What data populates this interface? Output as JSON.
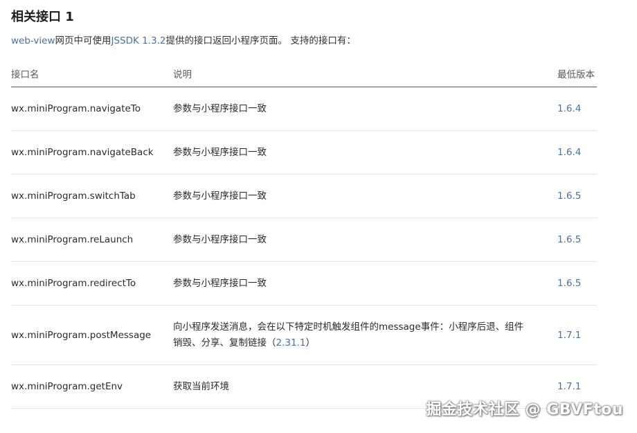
{
  "section": {
    "title": "相关接口 1"
  },
  "intro": {
    "link_text": "web-view",
    "text_1": "网页中可使用",
    "sdk_link_text": "JSSDK 1.3.2",
    "text_2": "提供的接口返回小程序页面。 支持的接口有："
  },
  "table": {
    "headers": {
      "name": "接口名",
      "desc": "说明",
      "version": "最低版本"
    },
    "rows": [
      {
        "name": "wx.miniProgram.navigateTo",
        "desc": "参数与小程序接口一致",
        "version": "1.6.4"
      },
      {
        "name": "wx.miniProgram.navigateBack",
        "desc": "参数与小程序接口一致",
        "version": "1.6.4"
      },
      {
        "name": "wx.miniProgram.switchTab",
        "desc": "参数与小程序接口一致",
        "version": "1.6.5"
      },
      {
        "name": "wx.miniProgram.reLaunch",
        "desc": "参数与小程序接口一致",
        "version": "1.6.5"
      },
      {
        "name": "wx.miniProgram.redirectTo",
        "desc": "参数与小程序接口一致",
        "version": "1.6.5"
      },
      {
        "name": "wx.miniProgram.postMessage",
        "desc": "向小程序发送消息，会在以下特定时机触发组件的message事件：小程序后退、组件销毁、分享、复制链接（",
        "desc_link": "2.31.1",
        "desc_tail": "）",
        "version": "1.7.1"
      },
      {
        "name": "wx.miniProgram.getEnv",
        "desc": "获取当前环境",
        "version": "1.7.1"
      }
    ]
  },
  "watermark": {
    "text": "掘金技术社区 @ GBVFtou"
  },
  "colors": {
    "link": "#4a6fa5",
    "text": "#2b2b2b",
    "header_text": "#5a5a5a",
    "divider": "#e6e6e6"
  }
}
